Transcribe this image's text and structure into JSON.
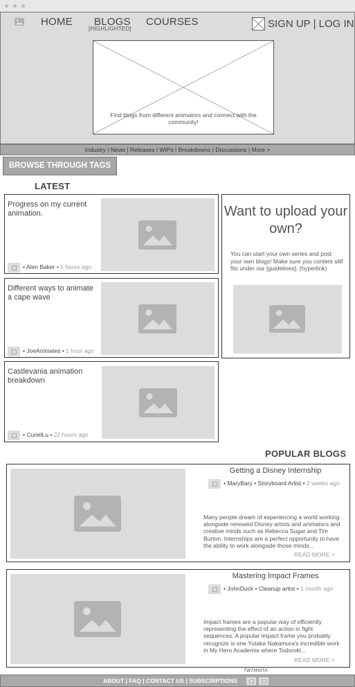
{
  "colors": {
    "header_bg": "#dcdcdc",
    "bar_bg": "#a9a9a9",
    "placeholder_bg": "#dcdcdc",
    "placeholder_icon": "#b3b3b3",
    "text": "#444444"
  },
  "header": {
    "logo_icon": "image-icon",
    "nav": [
      {
        "label": "HOME"
      },
      {
        "label": "BLOGS",
        "sub": "[HIGHLIGHTED]"
      },
      {
        "label": "COURSES"
      }
    ],
    "auth_icon": "placeholder-x-icon",
    "sign_up": "SIGN UP",
    "separator": "|",
    "log_in": "LOG IN"
  },
  "hero": {
    "text": "Find blogs from different animators and connect with the community!"
  },
  "categories": {
    "text": "Industry | News | Releases | WIPs | Breakdowns | Discussions | More >"
  },
  "browse_button": "BROWSE THROUGH TAGS",
  "latest": {
    "title": "LATEST",
    "items": [
      {
        "title": "Progress on my current animation.",
        "author": "Alen Baker",
        "time": "5 hours ago"
      },
      {
        "title": "Different ways to animate a cape wave",
        "author": "JoeAnimates",
        "time": "1 hour ago"
      },
      {
        "title": "Castlevania animation breakdown",
        "author": "CurielLu",
        "time": "22 hours ago"
      }
    ]
  },
  "upload": {
    "title": "Want to upload your own?",
    "text": "You can start your own series and post your own blogs! Make sure you content still fits under our [guidelines]. (hyperlink)"
  },
  "popular": {
    "title": "POPULAR BLOGS",
    "items": [
      {
        "title": "Getting a Disney Internship",
        "author": "MaryBary",
        "role": "Storyboard Artist",
        "time": "2 weeks ago",
        "excerpt": "Many people dream of experiencing a world working alongside renowed Disney artists and animators and creative minds such as Rebecca Sugar and Tim Burton. Internships are a perfect opportunity to have the ability to work alongside those minds...",
        "read_more": "READ MORE >"
      },
      {
        "title": "Mastering Impact Frames",
        "author": "JohnDuck",
        "role": "Cleanup artist",
        "time": "1 month ago",
        "excerpt": "Impact frames are a popular way of efficiently representing the effect of an action in fight sequences. A popular impact frame you probably recognize is one Yutaka Nakamura's incredible work in My Hero Academia where Todoroki...",
        "read_more": "READ MORE >"
      }
    ]
  },
  "footer": {
    "social_label": "TWT/INSTA",
    "links": [
      "ABOUT",
      "FAQ",
      "CONTACT US",
      "SUBSCRIPTIONS"
    ],
    "separator": "|",
    "social_icons": [
      "twitter-icon",
      "instagram-icon"
    ]
  }
}
